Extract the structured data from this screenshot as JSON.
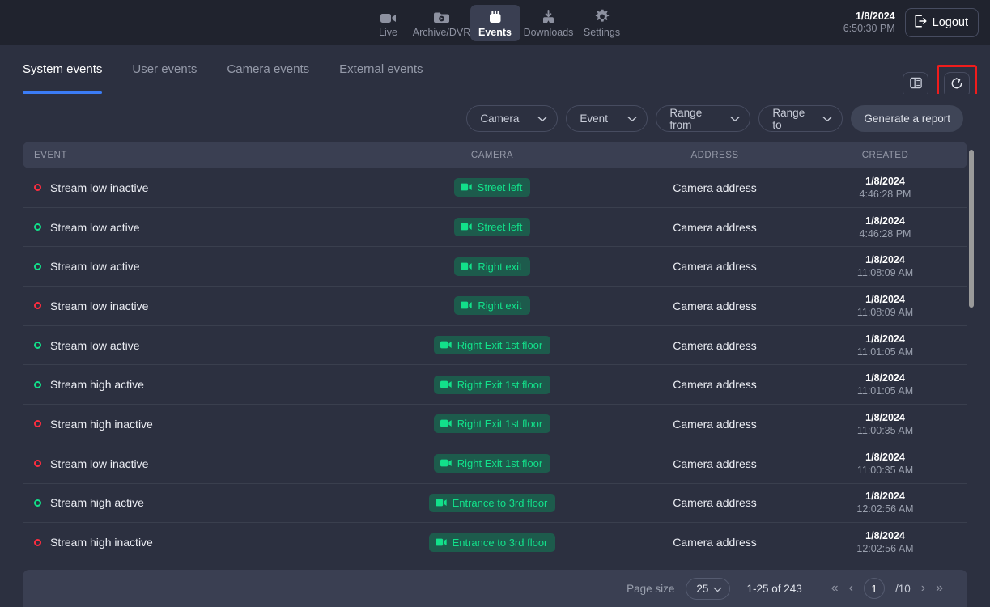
{
  "topnav": {
    "items": [
      {
        "label": "Live",
        "icon": "video-camera-icon",
        "active": false
      },
      {
        "label": "Archive/DVR",
        "icon": "archive-folder-icon",
        "active": false
      },
      {
        "label": "Events",
        "icon": "events-icon",
        "active": true
      },
      {
        "label": "Downloads",
        "icon": "download-icon",
        "active": false
      },
      {
        "label": "Settings",
        "icon": "gear-icon",
        "active": false
      }
    ],
    "clock": {
      "date": "1/8/2024",
      "time": "6:50:30 PM"
    },
    "logout_label": "Logout"
  },
  "tabs": [
    {
      "label": "System events",
      "active": true
    },
    {
      "label": "User events",
      "active": false
    },
    {
      "label": "Camera events",
      "active": false
    },
    {
      "label": "External events",
      "active": false
    }
  ],
  "tab_actions": {
    "columns_icon": "columns-layout-icon",
    "refresh_icon": "refresh-icon",
    "highlight_color": "#f01c1c"
  },
  "filters": {
    "camera": "Camera",
    "event": "Event",
    "range_from": "Range from",
    "range_to": "Range to",
    "generate_report": "Generate a report"
  },
  "table": {
    "columns": [
      "EVENT",
      "CAMERA",
      "ADDRESS",
      "CREATED"
    ],
    "rows": [
      {
        "status": "red",
        "event": "Stream low inactive",
        "camera": "Street left",
        "address": "Camera address",
        "date": "1/8/2024",
        "time": "4:46:28 PM"
      },
      {
        "status": "green",
        "event": "Stream low active",
        "camera": "Street left",
        "address": "Camera address",
        "date": "1/8/2024",
        "time": "4:46:28 PM"
      },
      {
        "status": "green",
        "event": "Stream low active",
        "camera": "Right exit",
        "address": "Camera address",
        "date": "1/8/2024",
        "time": "11:08:09 AM"
      },
      {
        "status": "red",
        "event": "Stream low inactive",
        "camera": "Right exit",
        "address": "Camera address",
        "date": "1/8/2024",
        "time": "11:08:09 AM"
      },
      {
        "status": "green",
        "event": "Stream low active",
        "camera": "Right Exit 1st floor",
        "address": "Camera address",
        "date": "1/8/2024",
        "time": "11:01:05 AM"
      },
      {
        "status": "green",
        "event": "Stream high active",
        "camera": "Right Exit 1st floor",
        "address": "Camera address",
        "date": "1/8/2024",
        "time": "11:01:05 AM"
      },
      {
        "status": "red",
        "event": "Stream high inactive",
        "camera": "Right Exit 1st floor",
        "address": "Camera address",
        "date": "1/8/2024",
        "time": "11:00:35 AM"
      },
      {
        "status": "red",
        "event": "Stream low inactive",
        "camera": "Right Exit 1st floor",
        "address": "Camera address",
        "date": "1/8/2024",
        "time": "11:00:35 AM"
      },
      {
        "status": "green",
        "event": "Stream high active",
        "camera": "Entrance to 3rd floor",
        "address": "Camera address",
        "date": "1/8/2024",
        "time": "12:02:56 AM"
      },
      {
        "status": "red",
        "event": "Stream high inactive",
        "camera": "Entrance to 3rd floor",
        "address": "Camera address",
        "date": "1/8/2024",
        "time": "12:02:56 AM"
      }
    ]
  },
  "footer": {
    "page_size_label": "Page size",
    "page_size_value": "25",
    "range_text": "1-25 of 243",
    "current_page": "1",
    "total_pages": "/10",
    "first_icon": "«",
    "prev_icon": "‹",
    "next_icon": "›",
    "last_icon": "»"
  },
  "colors": {
    "accent_blue": "#3b7cf6",
    "status_green": "#12e08a",
    "status_red": "#ff2d3f",
    "badge_bg": "#1d5b4c"
  }
}
